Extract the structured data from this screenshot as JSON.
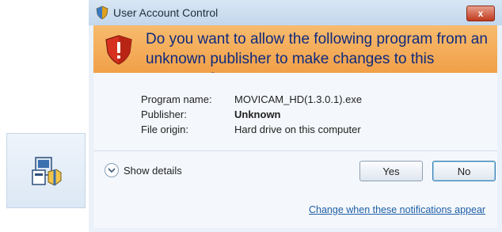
{
  "window": {
    "title": "User Account Control",
    "close_label": "x"
  },
  "banner": {
    "question": "Do you want to allow the following program from an unknown publisher to make changes to this computer?"
  },
  "info": {
    "program_name_label": "Program name:",
    "program_name_value": "MOVICAM_HD(1.3.0.1).exe",
    "publisher_label": "Publisher:",
    "publisher_value": "Unknown",
    "file_origin_label": "File origin:",
    "file_origin_value": "Hard drive on this computer"
  },
  "footer": {
    "show_details_label": "Show details",
    "yes_label": "Yes",
    "no_label": "No",
    "change_link": "Change when these notifications appear"
  },
  "icons": {
    "installer": "installer-icon",
    "shield": "uac-shield-icon"
  },
  "colors": {
    "banner": "#f1a048",
    "banner_text": "#0f2a7e",
    "link": "#1f5fa8"
  }
}
